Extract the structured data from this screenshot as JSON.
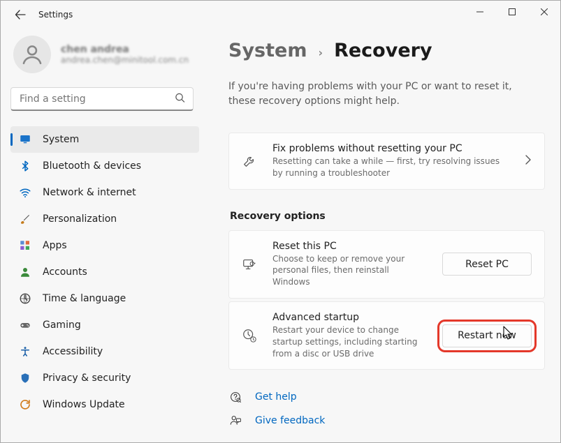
{
  "titlebar": {
    "title": "Settings"
  },
  "profile": {
    "name": "chen andrea",
    "email": "andrea.chen@minitool.com.cn"
  },
  "search": {
    "placeholder": "Find a setting"
  },
  "nav": [
    {
      "key": "system",
      "label": "System",
      "icon": "monitor",
      "active": true
    },
    {
      "key": "bluetooth-devices",
      "label": "Bluetooth & devices",
      "icon": "bluetooth",
      "active": false
    },
    {
      "key": "network-internet",
      "label": "Network & internet",
      "icon": "wifi",
      "active": false
    },
    {
      "key": "personalization",
      "label": "Personalization",
      "icon": "brush",
      "active": false
    },
    {
      "key": "apps",
      "label": "Apps",
      "icon": "apps",
      "active": false
    },
    {
      "key": "accounts",
      "label": "Accounts",
      "icon": "person",
      "active": false
    },
    {
      "key": "time-language",
      "label": "Time & language",
      "icon": "clock-globe",
      "active": false
    },
    {
      "key": "gaming",
      "label": "Gaming",
      "icon": "gamepad",
      "active": false
    },
    {
      "key": "accessibility",
      "label": "Accessibility",
      "icon": "accessibility",
      "active": false
    },
    {
      "key": "privacy-security",
      "label": "Privacy & security",
      "icon": "shield",
      "active": false
    },
    {
      "key": "windows-update",
      "label": "Windows Update",
      "icon": "update",
      "active": false
    }
  ],
  "breadcrumb": {
    "parent": "System",
    "current": "Recovery"
  },
  "lead": "If you're having problems with your PC or want to reset it, these recovery options might help.",
  "fix_problems": {
    "title": "Fix problems without resetting your PC",
    "sub": "Resetting can take a while — first, try resolving issues by running a troubleshooter"
  },
  "recovery_heading": "Recovery options",
  "reset_pc": {
    "title": "Reset this PC",
    "sub": "Choose to keep or remove your personal files, then reinstall Windows",
    "button": "Reset PC"
  },
  "advanced_startup": {
    "title": "Advanced startup",
    "sub": "Restart your device to change startup settings, including starting from a disc or USB drive",
    "button": "Restart now"
  },
  "help": {
    "get_help": "Get help",
    "give_feedback": "Give feedback"
  }
}
